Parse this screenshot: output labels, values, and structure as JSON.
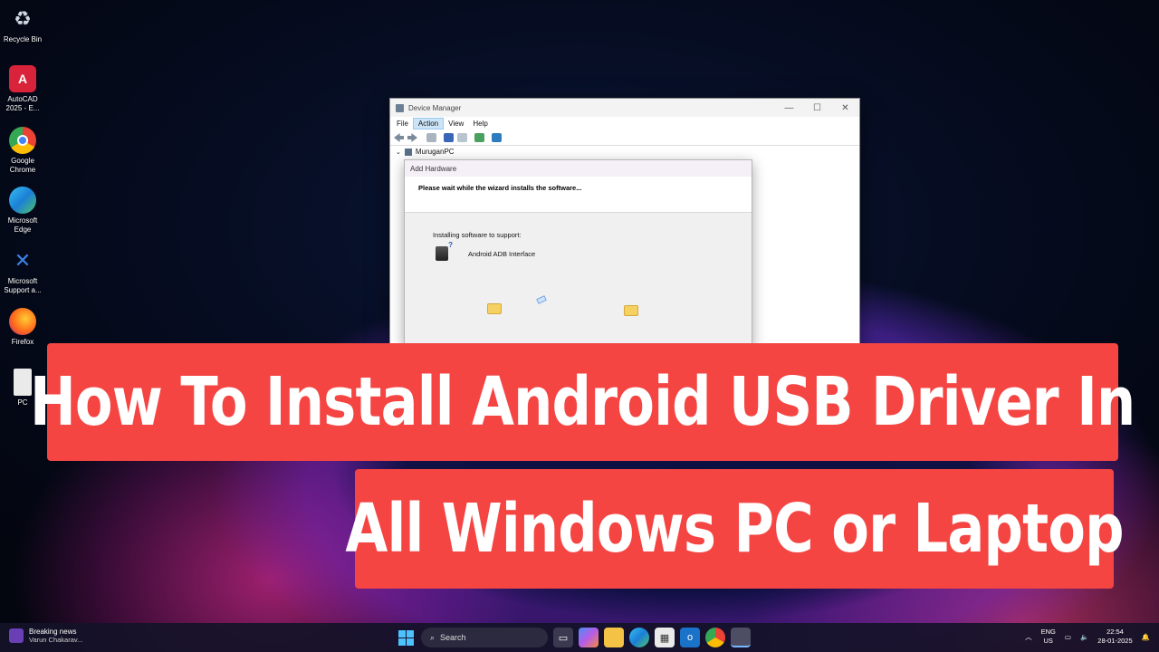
{
  "desktop": {
    "icons": [
      {
        "label": "Recycle Bin",
        "color": "#9aa7b5",
        "glyph": "♻"
      },
      {
        "label": "AutoCAD 2025 - E...",
        "color": "#d9233a",
        "glyph": "A"
      },
      {
        "label": "Google Chrome",
        "color": "#e8453c",
        "glyph": "◉"
      },
      {
        "label": "Microsoft Edge",
        "color": "#1a9fd6",
        "glyph": "e"
      },
      {
        "label": "Microsoft Support a...",
        "color": "#2a6fd6",
        "glyph": "✕"
      },
      {
        "label": "Firefox",
        "color": "#ff7a1a",
        "glyph": "◐"
      },
      {
        "label": "PC",
        "color": "#e6e6e6",
        "glyph": "▤"
      }
    ]
  },
  "device_manager": {
    "title": "Device Manager",
    "menu": [
      "File",
      "Action",
      "View",
      "Help"
    ],
    "active_menu": "Action",
    "tree_root": "MuruganPC",
    "window_controls": [
      "—",
      "☐",
      "✕"
    ]
  },
  "add_hardware": {
    "title": "Add Hardware",
    "heading": "Please wait while the wizard installs the software...",
    "installing_label": "Installing software to support:",
    "device_name": "Android ADB Interface"
  },
  "banner": {
    "line1": "How To Install Android USB Driver In",
    "line2": "All Windows PC or Laptop",
    "color": "#f44543"
  },
  "taskbar": {
    "news_title": "Breaking news",
    "news_sub": "Varun Chakarav...",
    "search_placeholder": "Search",
    "lang_top": "ENG",
    "lang_bottom": "US",
    "time": "22:54",
    "date": "28-01-2025",
    "apps": [
      "files-icon",
      "copilot-icon",
      "explorer-icon",
      "edge-icon",
      "store-icon",
      "outlook-icon",
      "chrome-icon",
      "device-manager-icon"
    ]
  }
}
